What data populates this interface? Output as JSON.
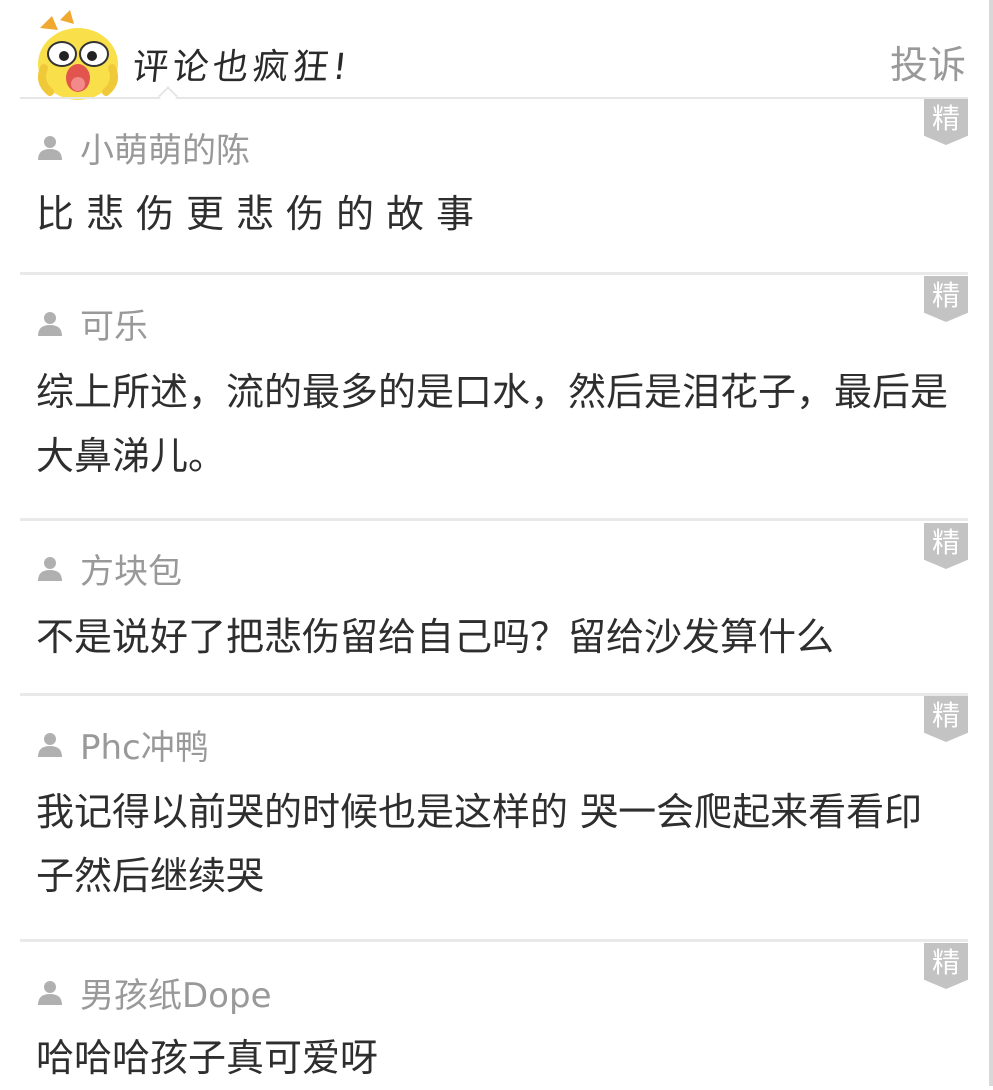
{
  "header": {
    "title": "评论也疯狂!",
    "report_label": "投诉"
  },
  "badge_label": "精",
  "comments": [
    {
      "username": "小萌萌的陈",
      "text": "比悲伤更悲伤的故事"
    },
    {
      "username": "可乐",
      "text": "综上所述，流的最多的是口水，然后是泪花子，最后是大鼻涕儿。"
    },
    {
      "username": "方块包",
      "text": "不是说好了把悲伤留给自己吗？留给沙发算什么"
    },
    {
      "username": "Phc冲鸭",
      "text": "我记得以前哭的时候也是这样的 哭一会爬起来看看印子然后继续哭"
    },
    {
      "username": "男孩纸Dope",
      "text": "哈哈哈孩子真可爱呀"
    }
  ],
  "colors": {
    "badge": "#c3c3c3",
    "username": "#999999",
    "text": "#2e2e2e",
    "mascot": "#f9e04b"
  }
}
